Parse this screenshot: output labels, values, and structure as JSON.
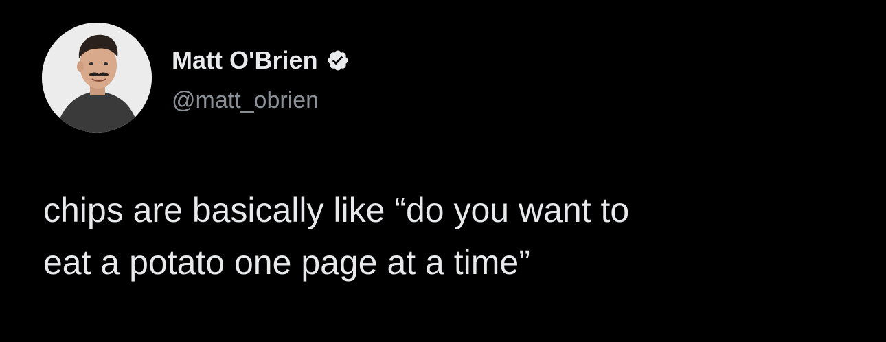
{
  "author": {
    "display_name": "Matt O'Brien",
    "handle": "@matt_obrien",
    "verified": true,
    "verified_icon": "verified-badge-icon"
  },
  "tweet": {
    "lines": [
      "chips are basically like “do you want to",
      "eat a potato one page at a time”"
    ]
  },
  "colors": {
    "background": "#000000",
    "primary_text": "#e7e9ea",
    "secondary_text": "#8b9096",
    "badge": "#e7e9ea"
  }
}
